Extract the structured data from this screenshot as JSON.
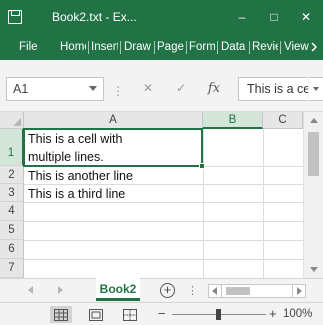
{
  "window": {
    "title": "Book2.txt  -  Ex...",
    "minimize": "–",
    "maximize": "□",
    "close": "✕"
  },
  "ribbon": {
    "tabs": [
      "File",
      "Home",
      "Insert",
      "Draw",
      "Page",
      "Formulas",
      "Data",
      "Review",
      "View"
    ]
  },
  "formula_bar": {
    "name_box": "A1",
    "more": "⋮",
    "cancel": "✕",
    "enter": "✓",
    "function": "fx",
    "content": "This is a cell with multiple lines."
  },
  "grid": {
    "columns": [
      "A",
      "B",
      "C"
    ],
    "active_column": "B",
    "rows": [
      "1",
      "2",
      "3",
      "4",
      "5",
      "6",
      "7"
    ],
    "cells": {
      "a1_line1": "This is a cell with",
      "a1_line2": "multiple lines.",
      "a2": "This is another line",
      "a3": "This is a third line"
    }
  },
  "sheets": {
    "active": "Book2",
    "add": "+",
    "more": "⋮"
  },
  "status_bar": {
    "zoom_minus": "−",
    "zoom_plus": "+",
    "zoom": "100%",
    "zoom_level": 1.0
  },
  "colors": {
    "accent": "#217346",
    "selection_header": "#d3e5d8"
  }
}
